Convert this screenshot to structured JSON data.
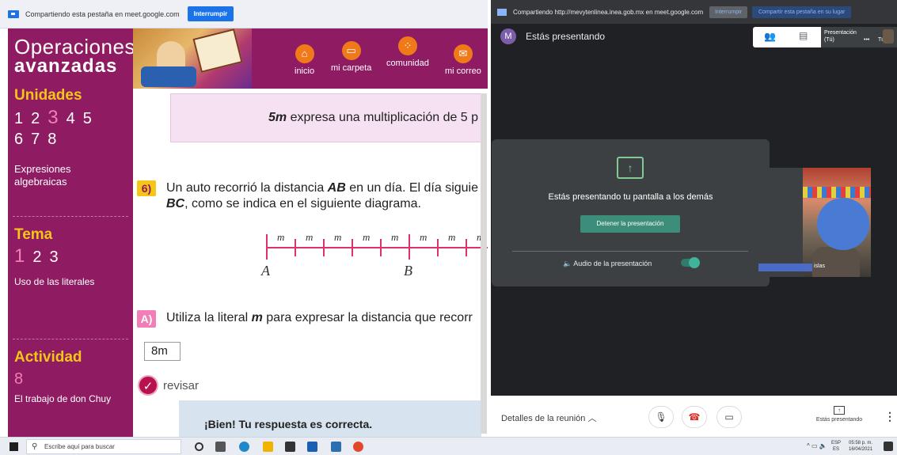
{
  "left_share_bar": {
    "text": "Compartiendo esta pestaña en meet.google.com",
    "stop_label": "Interrumpir"
  },
  "sidebar": {
    "brand_line1": "Operaciones",
    "brand_line2": "avanzadas",
    "units": {
      "title": "Unidades",
      "numbers": [
        "1",
        "2",
        "3",
        "4",
        "5",
        "6",
        "7",
        "8"
      ],
      "current": "3",
      "topic": "Expresiones algebraicas"
    },
    "tema": {
      "title": "Tema",
      "numbers": [
        "1",
        "2",
        "3"
      ],
      "current": "1",
      "topic": "Uso de las literales"
    },
    "actividad": {
      "title": "Actividad",
      "number": "8",
      "topic": "El trabajo de don Chuy"
    }
  },
  "top_nav": [
    {
      "label": "inicio",
      "icon": "home-icon"
    },
    {
      "label": "mi carpeta",
      "icon": "folder-icon"
    },
    {
      "label": "comunidad",
      "icon": "community-icon"
    },
    {
      "label": "mi correo",
      "icon": "mail-icon"
    }
  ],
  "content": {
    "note_bold": "5m",
    "note_rest": " expresa una multiplicación de 5 p",
    "q6_label": "6)",
    "q6_text_a": "Un auto recorrió la distancia ",
    "q6_text_b": "AB",
    "q6_text_c": " en un día. El día siguie",
    "q6_text_d": "BC",
    "q6_text_e": ", como se indica en el siguiente diagrama.",
    "ruler_unit": "m",
    "ruler_points": [
      "A",
      "B"
    ],
    "qa_label": "A)",
    "qa_text_a": "Utiliza la literal ",
    "qa_text_b": "m",
    "qa_text_c": " para expresar la distancia que recorr",
    "answer_value": "8m",
    "check_label": "revisar",
    "feedback": "¡Bien! Tu respuesta es correcta."
  },
  "meet": {
    "share_bar": {
      "text": "Compartiendo http://mevytenlinea.inea.gob.mx en meet.google.com",
      "stop_label": "Interrumpir",
      "switch_label": "Compartir esta pestaña en su lugar"
    },
    "avatar_letter": "M",
    "header_title": "Estás presentando",
    "top_tile": {
      "line1": "Presentación",
      "line2": "(Tú)",
      "you": "Tú"
    },
    "card": {
      "message": "Estás presentando tu pantalla a los demás",
      "stop_label": "Detener la presentación",
      "audio_label": "Audio de la presentación"
    },
    "participant_name": "islas",
    "bottom": {
      "details_label": "Detalles de la reunión",
      "presenting_label": "Estás presentando"
    }
  },
  "taskbar": {
    "search_placeholder": "Escribe aquí para buscar",
    "lang_top": "ESP",
    "lang_bottom": "ES",
    "time": "05:58 p. m.",
    "date": "16/04/2021"
  }
}
